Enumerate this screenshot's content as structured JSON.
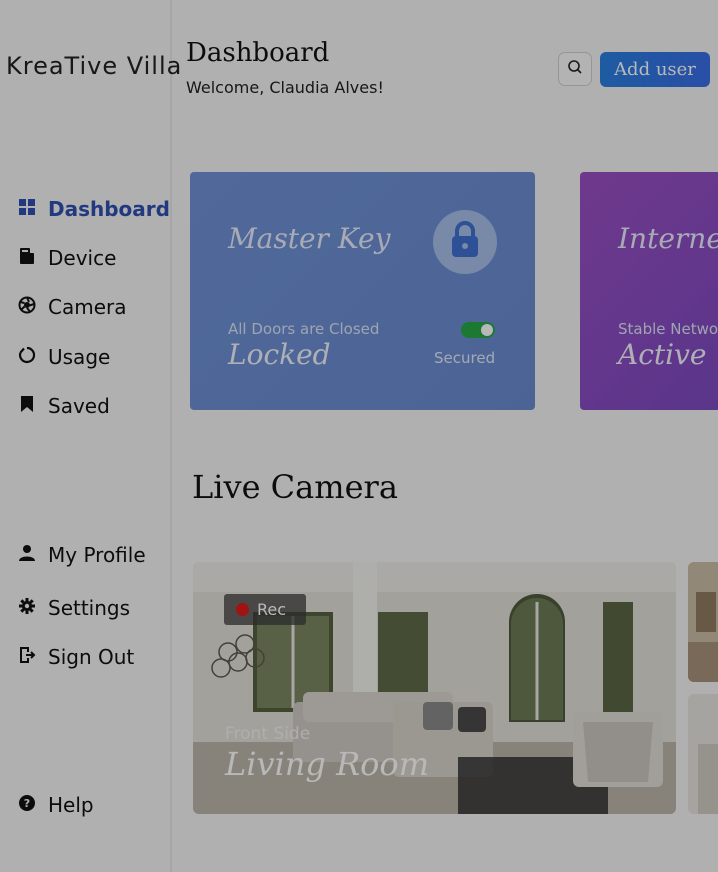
{
  "brand": {
    "logo": "KreaTive Villa"
  },
  "sidebar": {
    "nav": [
      {
        "label": "Dashboard",
        "icon": "grid-icon",
        "active": true
      },
      {
        "label": "Device",
        "icon": "device-icon"
      },
      {
        "label": "Camera",
        "icon": "camera-icon"
      },
      {
        "label": "Usage",
        "icon": "usage-icon"
      },
      {
        "label": "Saved",
        "icon": "bookmark-icon"
      }
    ],
    "account": [
      {
        "label": "My Profile",
        "icon": "user-icon"
      },
      {
        "label": "Settings",
        "icon": "gear-icon"
      },
      {
        "label": "Sign Out",
        "icon": "sign-out-icon"
      }
    ],
    "help": {
      "label": "Help",
      "icon": "help-icon"
    }
  },
  "header": {
    "title": "Dashboard",
    "welcome": "Welcome, Claudia Alves!",
    "add_user_label": "Add user"
  },
  "cards": {
    "master_key": {
      "title": "Master Key",
      "status_sub": "All Doors are Closed",
      "status_main": "Locked",
      "toggle_label": "Secured",
      "toggle_on": true
    },
    "internet": {
      "title": "Internet",
      "status_sub": "Stable Netwo",
      "status_main": "Active"
    }
  },
  "live_camera": {
    "section_title": "Live Camera",
    "main_feed": {
      "rec_label": "Rec",
      "location_sub": "Front Side",
      "location_title": "Living Room"
    }
  },
  "colors": {
    "accent": "#2e4fb0",
    "add_button": "#2a7fe0",
    "master_key_card": "#6f92d6",
    "internet_card": "#9a4fc4",
    "toggle_on": "#27a844",
    "rec_dot": "#e01919"
  }
}
